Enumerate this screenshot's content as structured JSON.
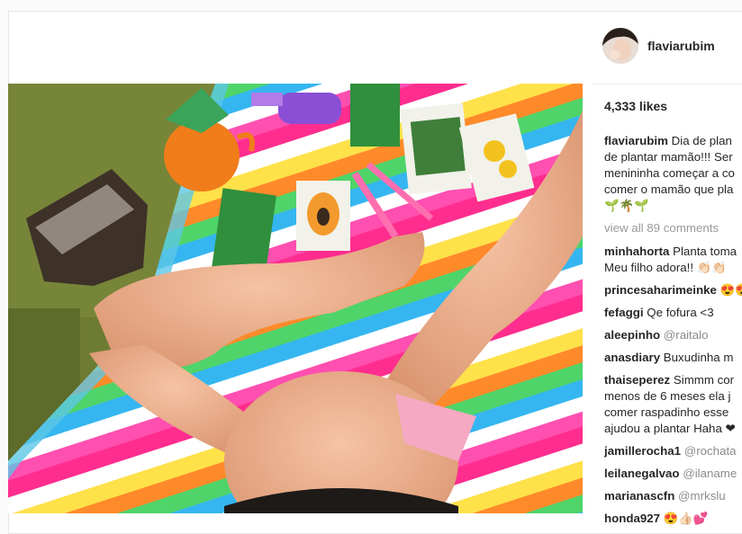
{
  "post": {
    "username": "flaviarubim",
    "likes": "4,333 likes",
    "caption": {
      "user": "flaviarubim",
      "lines": [
        "Dia de plan",
        "de plantar mamão!!! Ser",
        "menininha começar a co",
        "comer o mamão que pla",
        "🌱🌴🌱"
      ]
    },
    "view_all": "view all 89 comments",
    "comments": [
      {
        "user": "minhahorta",
        "lines": [
          "Planta toma",
          "Meu filho adora!! 👏🏻👏🏻"
        ]
      },
      {
        "user": "princesaharimeinke",
        "lines": [
          "😍😍"
        ]
      },
      {
        "user": "fefaggi",
        "lines": [
          "Qe fofura <3"
        ]
      },
      {
        "user": "aleepinho",
        "lines": [
          "@raitalo"
        ]
      },
      {
        "user": "anasdiary",
        "lines": [
          "Buxudinha m"
        ]
      },
      {
        "user": "thaiseperez",
        "lines": [
          "Simmm cor",
          "menos de 6 meses ela j",
          "comer raspadinho esse",
          "ajudou a plantar Haha ❤"
        ]
      },
      {
        "user": "jamillerocha1",
        "lines": [
          "@rochata"
        ]
      },
      {
        "user": "leilanegalvao",
        "lines": [
          "@ilaname"
        ]
      },
      {
        "user": "marianascfn",
        "lines": [
          "@mrkslu"
        ]
      },
      {
        "user": "honda927",
        "lines": [
          "😍👍🏻💕"
        ]
      }
    ]
  },
  "colors": {
    "text": "#262626",
    "muted": "#999999",
    "border": "#e6e6e6"
  }
}
